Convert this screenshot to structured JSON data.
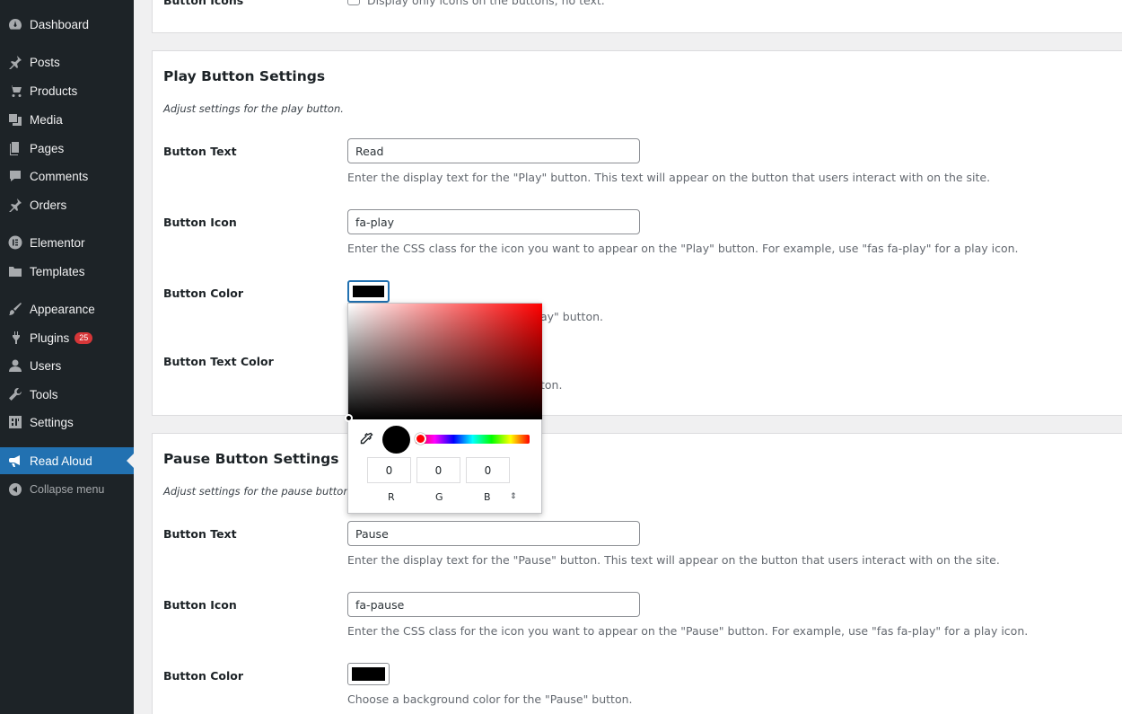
{
  "sidebar": {
    "items": [
      {
        "label": "Dashboard",
        "icon": "dashboard-icon"
      },
      {
        "label": "Posts",
        "icon": "pin-icon"
      },
      {
        "label": "Products",
        "icon": "cart-icon"
      },
      {
        "label": "Media",
        "icon": "media-icon"
      },
      {
        "label": "Pages",
        "icon": "page-icon"
      },
      {
        "label": "Comments",
        "icon": "comment-icon"
      },
      {
        "label": "Orders",
        "icon": "pin-icon"
      },
      {
        "label": "Elementor",
        "icon": "elementor-icon"
      },
      {
        "label": "Templates",
        "icon": "folder-icon"
      },
      {
        "label": "Appearance",
        "icon": "brush-icon"
      },
      {
        "label": "Plugins",
        "icon": "plugin-icon",
        "badge": "25"
      },
      {
        "label": "Users",
        "icon": "user-icon"
      },
      {
        "label": "Tools",
        "icon": "wrench-icon"
      },
      {
        "label": "Settings",
        "icon": "settings-icon"
      },
      {
        "label": "Read Aloud",
        "icon": "megaphone-icon",
        "active": true
      },
      {
        "label": "Collapse menu",
        "icon": "collapse-icon"
      }
    ]
  },
  "top_panel": {
    "label": "Button Icons",
    "checkbox_text": "Display only icons on the buttons, no text."
  },
  "play": {
    "title": "Play Button Settings",
    "desc": "Adjust settings for the play button.",
    "text_label": "Button Text",
    "text_value": "Read",
    "text_help": "Enter the display text for the \"Play\" button. This text will appear on the button that users interact with on the site.",
    "icon_label": "Button Icon",
    "icon_value": "fa-play",
    "icon_help": "Enter the CSS class for the icon you want to appear on the \"Play\" button. For example, use \"fas fa-play\" for a play icon.",
    "color_label": "Button Color",
    "color_help_tail": "ay\" button.",
    "textcolor_label": "Button Text Color",
    "textcolor_help_tail": "ton."
  },
  "picker": {
    "r": "0",
    "g": "0",
    "b": "0",
    "r_label": "R",
    "g_label": "G",
    "b_label": "B",
    "toggle_glyph": "⇕",
    "color": "#000000"
  },
  "pause": {
    "title": "Pause Button Settings",
    "desc": "Adjust settings for the pause button.",
    "text_label": "Button Text",
    "text_value": "Pause",
    "text_help": "Enter the display text for the \"Pause\" button. This text will appear on the button that users interact with on the site.",
    "icon_label": "Button Icon",
    "icon_value": "fa-pause",
    "icon_help": "Enter the CSS class for the icon you want to appear on the \"Pause\" button. For example, use \"fas fa-play\" for a play icon.",
    "color_label": "Button Color",
    "color_help": "Choose a background color for the \"Pause\" button."
  },
  "colors": {
    "sidebar_bg": "#1d2327",
    "accent": "#2271b1",
    "badge": "#d63638"
  }
}
